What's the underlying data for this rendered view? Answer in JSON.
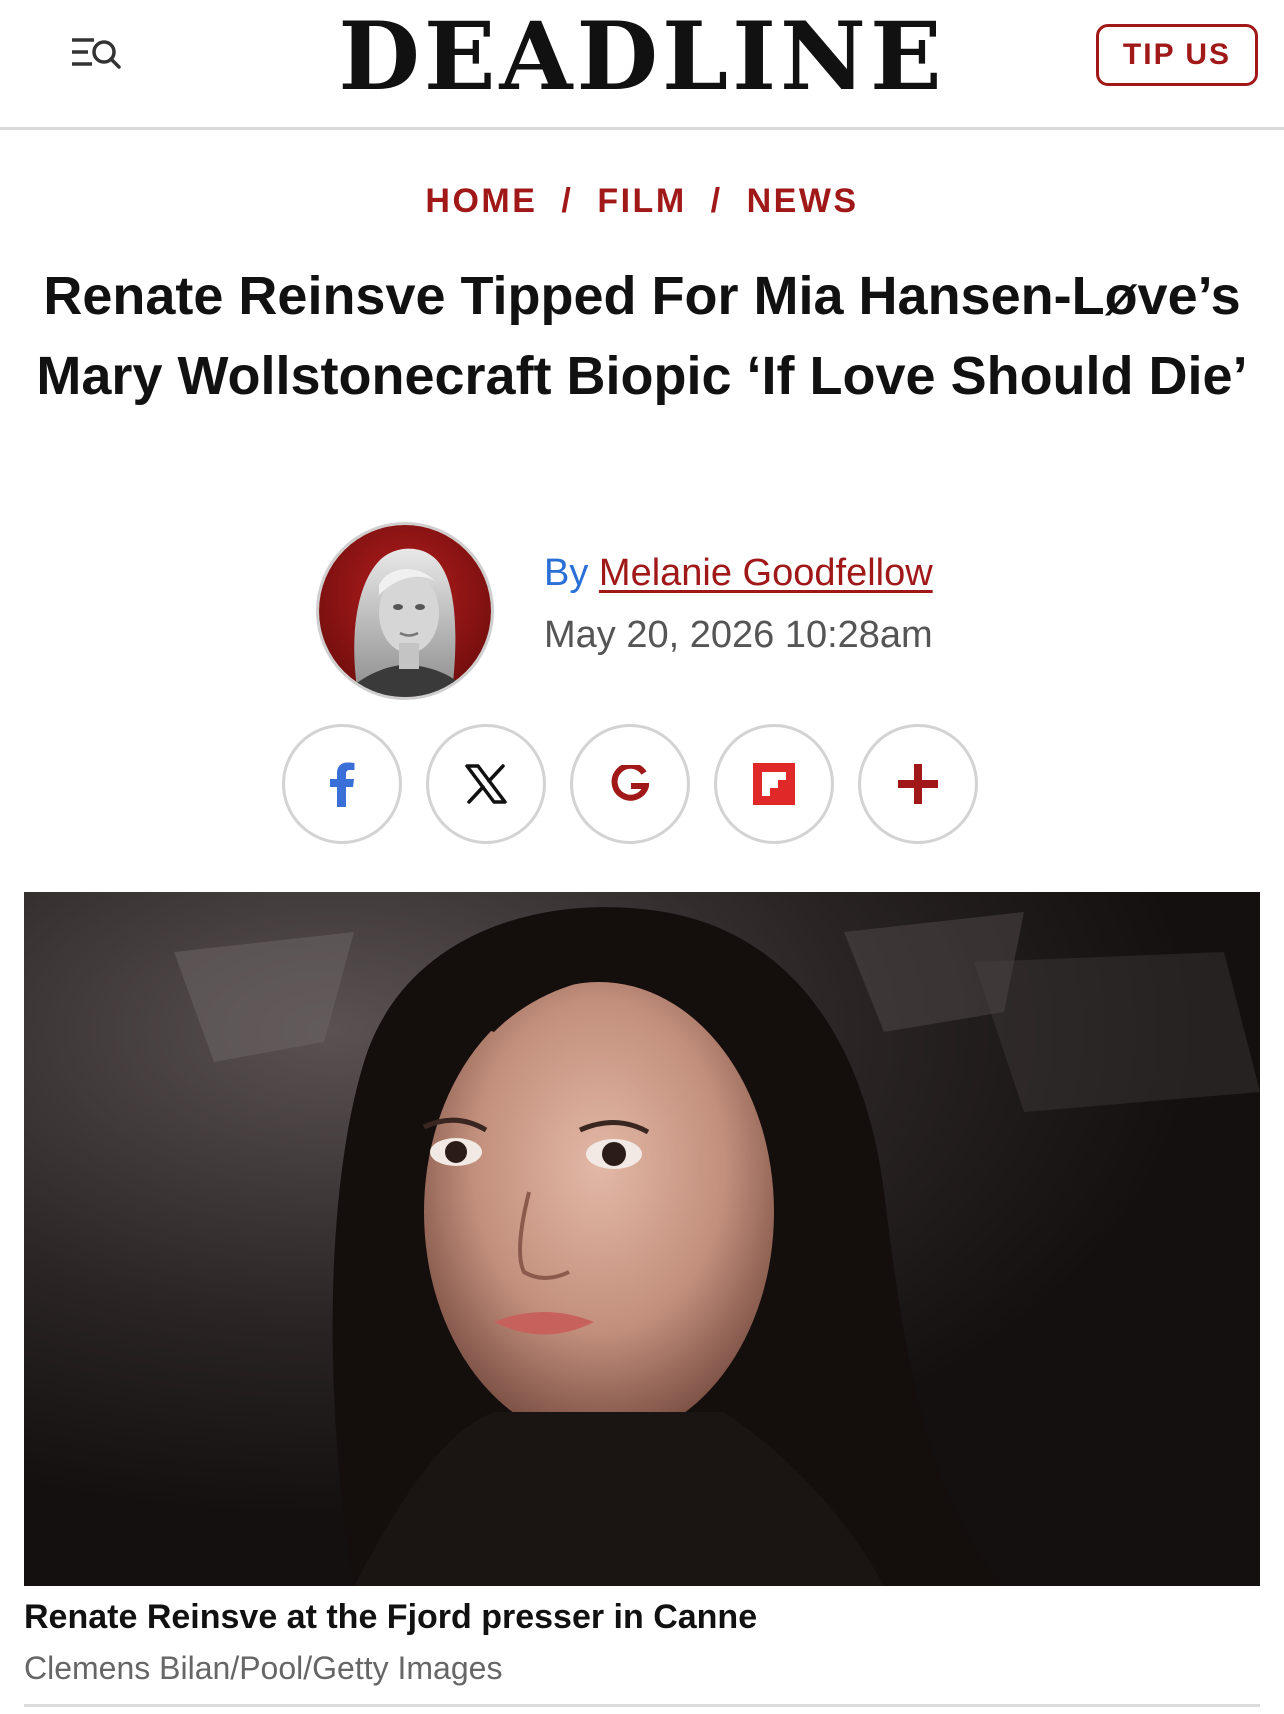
{
  "header": {
    "logo": "DEADLINE",
    "tip_label": "TIP US"
  },
  "breadcrumb": {
    "items": [
      "HOME",
      "FILM",
      "NEWS"
    ],
    "separator": "/"
  },
  "article": {
    "headline": "Renate Reinsve Tipped For Mia Hansen-Løve’s Mary Wollstonecraft Biopic ‘If Love Should Die’",
    "by_label": "By",
    "author": "Melanie Goodfellow",
    "date": "May 20, 2026 10:28am",
    "caption": "Renate Reinsve at the Fjord presser in Canne",
    "credit": "Clemens Bilan/Pool/Getty Images"
  },
  "share": [
    {
      "icon": "facebook-icon",
      "color": "#3b6fd8"
    },
    {
      "icon": "x-icon",
      "color": "#111111"
    },
    {
      "icon": "google-icon",
      "color": "#a01818"
    },
    {
      "icon": "flipboard-icon",
      "color": "#e12828"
    },
    {
      "icon": "plus-icon",
      "color": "#a01818"
    }
  ],
  "colors": {
    "accent": "#a01818",
    "byline_blue": "#2a6fd6",
    "text": "#111111",
    "muted": "#666666"
  }
}
